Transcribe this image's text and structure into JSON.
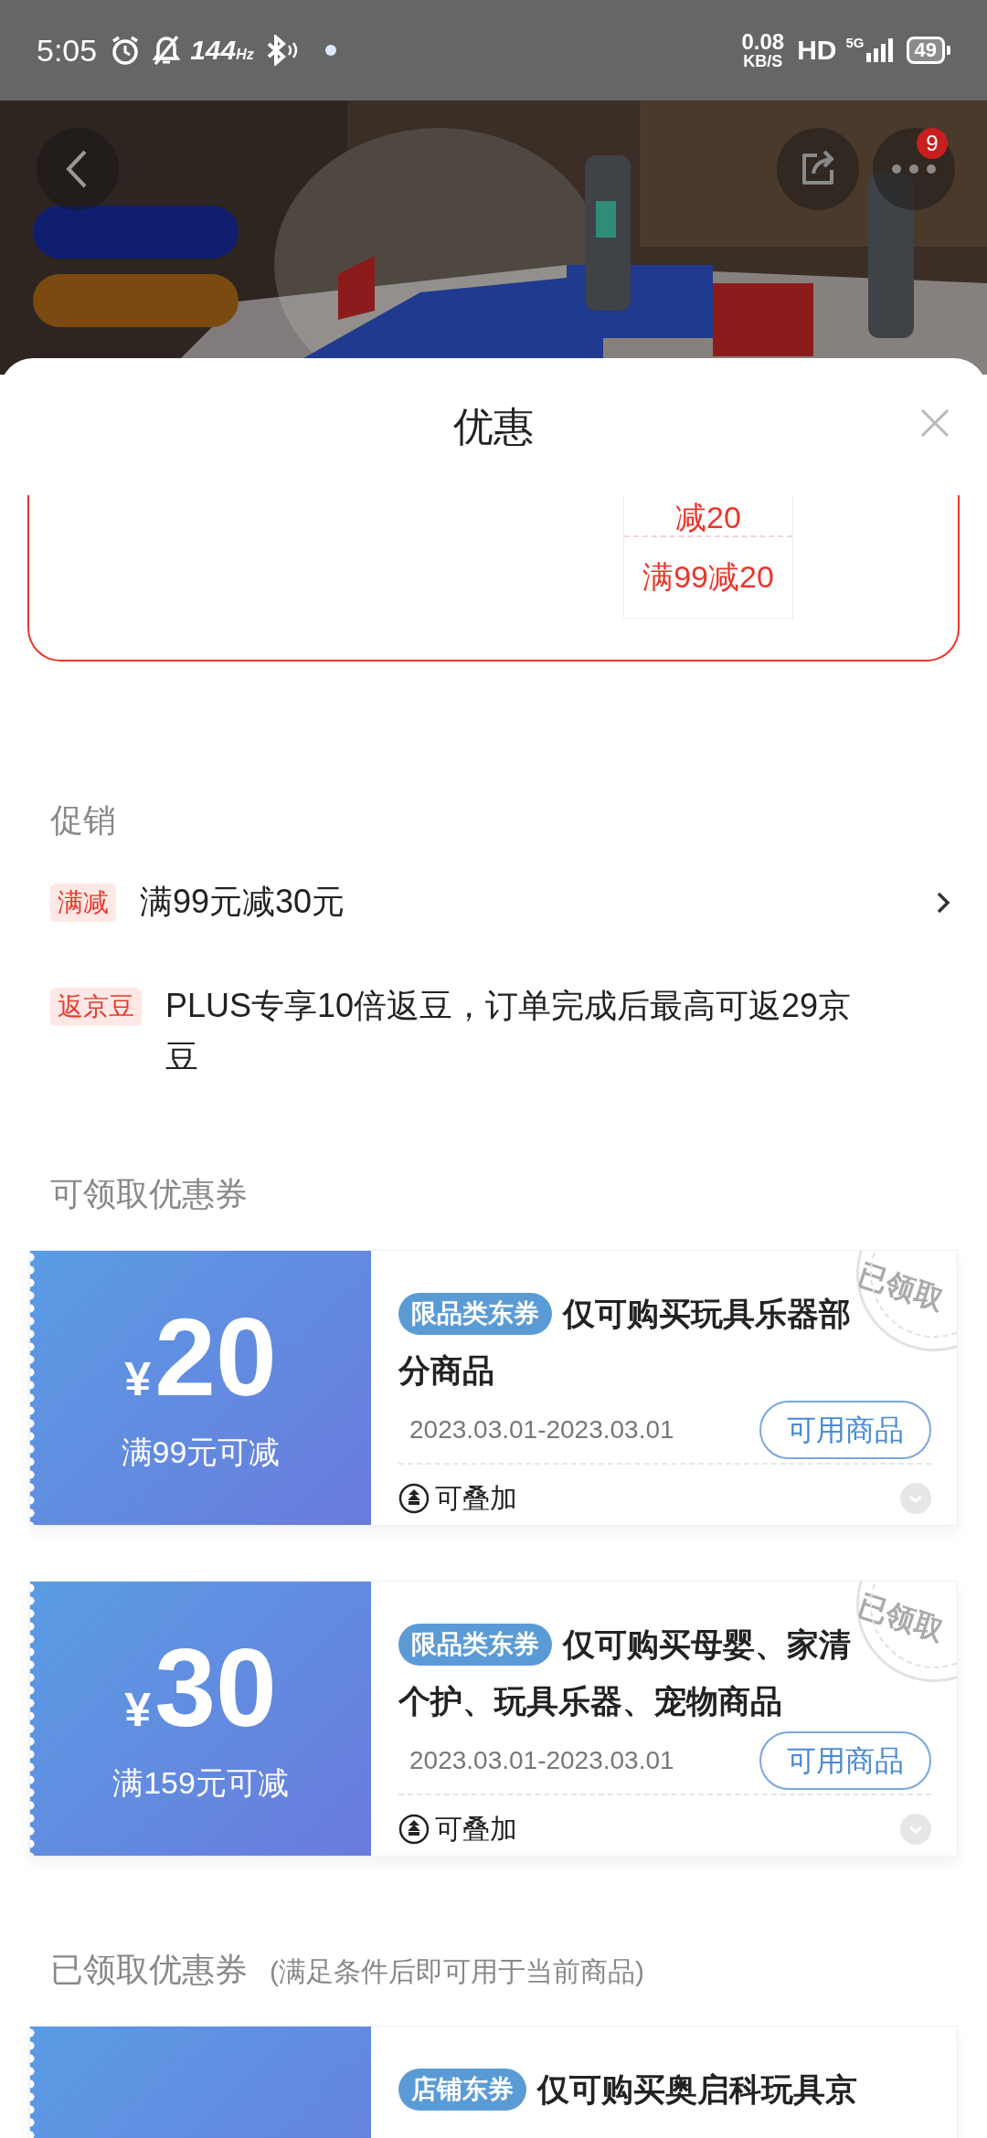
{
  "status_bar": {
    "time": "5:05",
    "refresh_rate": "144",
    "refresh_unit": "Hz",
    "net_speed": "0.08",
    "net_unit": "KB/S",
    "hd": "HD",
    "network": "5G",
    "battery": "49"
  },
  "hero": {
    "kind": "picture",
    "more_badge": "9"
  },
  "sheet": {
    "title": "优惠"
  },
  "partial_card": {
    "offers": [
      "减20",
      "满99减20"
    ]
  },
  "promotions": {
    "heading": "促销",
    "items": [
      {
        "tag": "满减",
        "text": "满99元减30元",
        "has_arrow": true
      },
      {
        "tag": "返京豆",
        "text": "PLUS专享10倍返豆，订单完成后最高可返29京豆",
        "has_arrow": false
      }
    ]
  },
  "available": {
    "heading": "可领取优惠券",
    "coupons": [
      {
        "currency": "¥",
        "amount": "20",
        "condition": "满99元可减",
        "tag": "限品类东券",
        "title": "仅可购买玩具乐器部分商品",
        "date": "2023.03.01-2023.03.01",
        "button": "可用商品",
        "stack_label": "可叠加",
        "stamp": "已领取"
      },
      {
        "currency": "¥",
        "amount": "30",
        "condition": "满159元可减",
        "tag": "限品类东券",
        "title": "仅可购买母婴、家清个护、玩具乐器、宠物商品",
        "date": "2023.03.01-2023.03.01",
        "button": "可用商品",
        "stack_label": "可叠加",
        "stamp": "已领取"
      }
    ]
  },
  "claimed": {
    "heading": "已领取优惠券",
    "note": "(满足条件后即可用于当前商品)",
    "coupons": [
      {
        "tag": "店铺东券",
        "title": "仅可购买奥启科玩具京"
      }
    ]
  }
}
